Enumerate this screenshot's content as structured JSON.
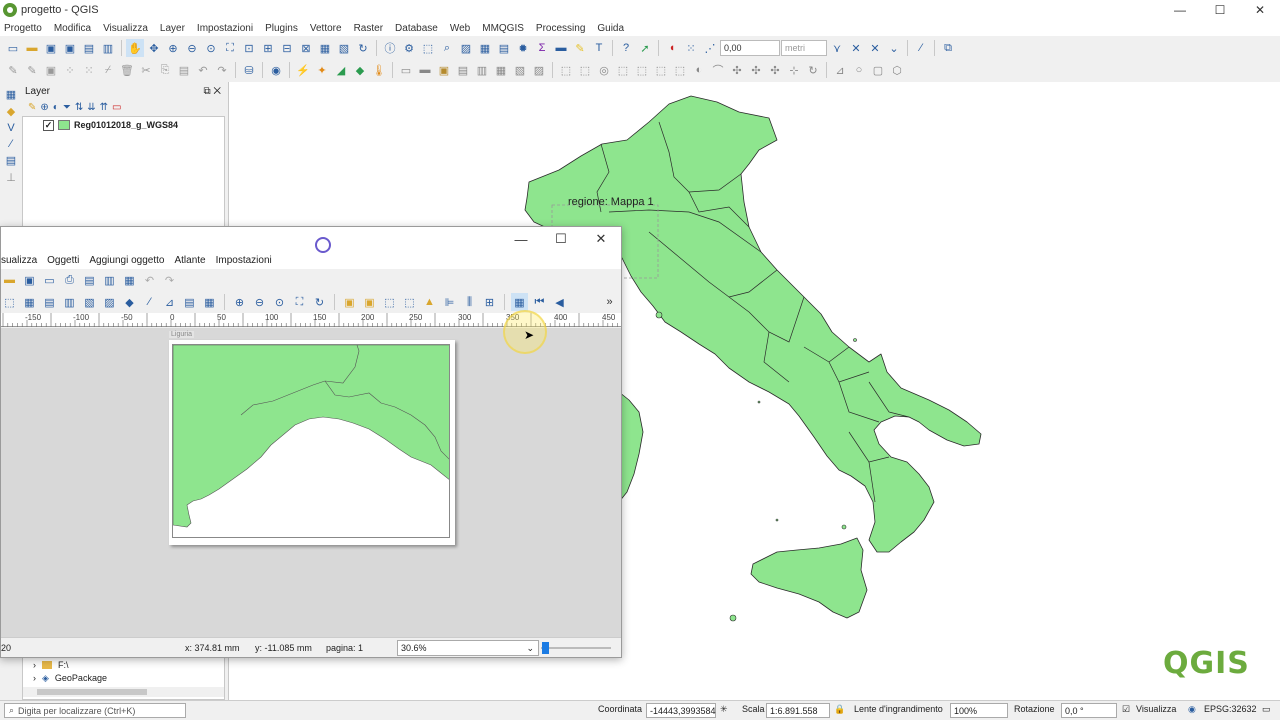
{
  "window": {
    "title": "progetto - QGIS",
    "minimize": "—",
    "maximize": "☐",
    "close": "✕"
  },
  "menu": [
    "Progetto",
    "Modifica",
    "Visualizza",
    "Layer",
    "Impostazioni",
    "Plugins",
    "Vettore",
    "Raster",
    "Database",
    "Web",
    "MMQGIS",
    "Processing",
    "Guida"
  ],
  "toolbar1": {
    "scale_value": "0,00",
    "units": "metri",
    "text_tool": "T"
  },
  "layers_panel": {
    "title": "Layer",
    "layers": [
      {
        "name": "Reg01012018_g_WGS84",
        "checked": "✓",
        "color": "#8ee58e"
      }
    ]
  },
  "browser_panel": {
    "items": [
      "F:\\",
      "GeoPackage"
    ]
  },
  "map": {
    "label": "regione: Mappa 1",
    "fill": "#8ee58e"
  },
  "composer": {
    "minimize": "—",
    "maximize": "☐",
    "close": "✕",
    "menu": [
      "sualizza",
      "Oggetti",
      "Aggiungi oggetto",
      "Atlante",
      "Impostazioni"
    ],
    "ruler_ticks": [
      "-150",
      "-100",
      "-50",
      "0",
      "50",
      "100",
      "150",
      "200",
      "250",
      "300",
      "350",
      "400",
      "450"
    ],
    "map_item_label": "Liguria",
    "status": {
      "left": "20",
      "x": "x: 374.81 mm",
      "y": "y: -11.085 mm",
      "page": "pagina: 1",
      "zoom": "30.6%"
    }
  },
  "statusbar": {
    "locator_placeholder": "Digita per localizzare (Ctrl+K)",
    "coord_label": "Coordinata",
    "coord_value": "-14443,3993584",
    "scale_label": "Scala",
    "scale_value": "1:6.891.558",
    "magnifier_label": "Lente d'ingrandimento",
    "magnifier_value": "100%",
    "rotation_label": "Rotazione",
    "rotation_value": "0,0 °",
    "render_label": "Visualizza",
    "crs": "EPSG:32632"
  },
  "logo": "QGIS"
}
